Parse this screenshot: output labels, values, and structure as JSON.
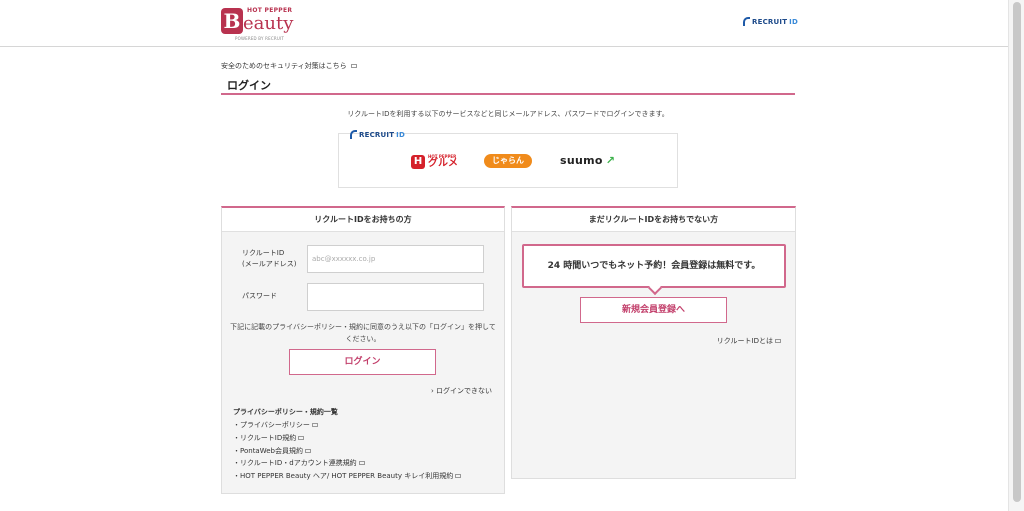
{
  "brand": {
    "hotpepper": "HOT PEPPER",
    "b_letter": "B",
    "beauty": "eauty",
    "powered": "POWERED BY RECRUIT",
    "recruit_id_label": "RECRUIT",
    "recruit_id_suffix": "ID",
    "accent_color": "#d1688c"
  },
  "security_link": "安全のためのセキュリティ対策はこちら",
  "page_title": "ログイン",
  "description": "リクルートIDを利用する以下のサービスなどと同じメールアドレス、パスワードでログインできます。",
  "services": {
    "gourmet_h": "H",
    "gourmet_small": "HOT PEPPER",
    "gourmet_label": "グルメ",
    "jalan_label": "じゃらん",
    "suumo_label": "suumo"
  },
  "login_panel": {
    "header": "リクルートIDをお持ちの方",
    "id_label_1": "リクルートID",
    "id_label_2": "(メールアドレス)",
    "id_placeholder": "abc@xxxxxx.co.jp",
    "password_label": "パスワード",
    "notice": "下記に記載のプライバシーポリシー・規約に同意のうえ以下の「ログイン」を押してください。",
    "login_button": "ログイン",
    "cant_login": "› ログインできない",
    "policy_title": "プライバシーポリシー・規約一覧",
    "policy_links": [
      "・プライバシーポリシー",
      "・リクルートID規約",
      "・PontaWeb会員規約",
      "・リクルートID・dアカウント連携規約",
      "・HOT PEPPER Beauty ヘア/ HOT PEPPER Beauty キレイ利用規約"
    ]
  },
  "register_panel": {
    "header": "まだリクルートIDをお持ちでない方",
    "promo": "24 時間いつでもネット予約！会員登録は無料です。",
    "register_button": "新規会員登録へ",
    "about_link": "リクルートIDとは"
  }
}
